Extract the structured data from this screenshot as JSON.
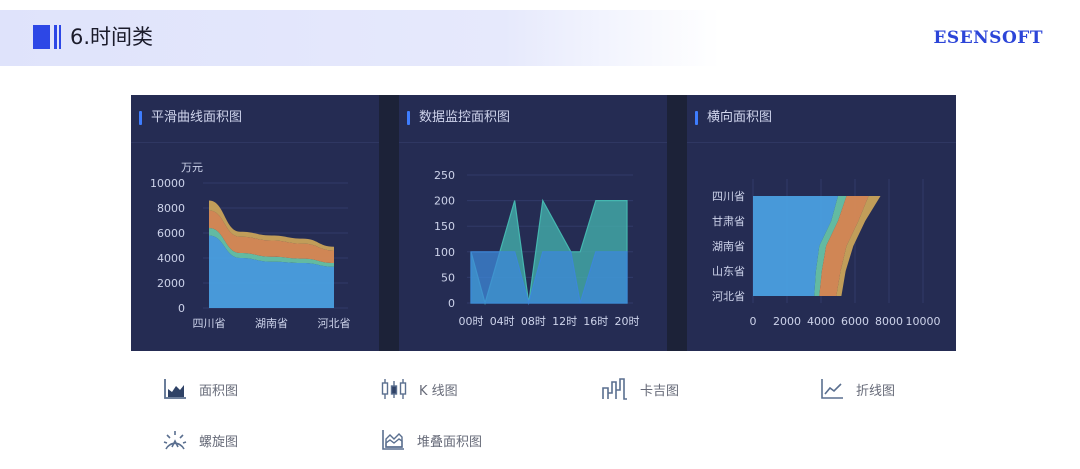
{
  "header": {
    "title": "6.时间类",
    "brand": "ESENSOFT",
    "accent_color": "#2d47e6"
  },
  "panels": [
    {
      "title": "平滑曲线面积图"
    },
    {
      "title": "数据监控面积图"
    },
    {
      "title": "横向面积图"
    }
  ],
  "chart_data": [
    {
      "type": "area",
      "title": "平滑曲线面积图",
      "ylabel": "万元",
      "categories": [
        "四川省",
        "",
        "湖南省",
        "",
        "河北省"
      ],
      "y_ticks": [
        "0",
        "2000",
        "4000",
        "6000",
        "8000",
        "10000"
      ],
      "ylim": [
        0,
        10000
      ],
      "stacked": true,
      "series": [
        {
          "values": [
            5800,
            4000,
            3700,
            3600,
            3300
          ],
          "color": "#4a9fe0"
        },
        {
          "values": [
            600,
            400,
            400,
            350,
            300
          ],
          "color": "#66c2a5"
        },
        {
          "values": [
            1400,
            1300,
            1300,
            1200,
            1000
          ],
          "color": "#d98b55"
        },
        {
          "values": [
            800,
            400,
            400,
            400,
            300
          ],
          "color": "#c9a35a"
        }
      ]
    },
    {
      "type": "area",
      "title": "数据监控面积图",
      "x": [
        "00时",
        "04时",
        "08时",
        "12时",
        "16时",
        "20时"
      ],
      "y_ticks": [
        "0",
        "50",
        "100",
        "150",
        "200",
        "250"
      ],
      "ylim": [
        0,
        250
      ],
      "series": [
        {
          "values": [
            100,
            0,
            200,
            0,
            200,
            100,
            100,
            200,
            200,
            200
          ],
          "color": "#45b7b0"
        },
        {
          "values": [
            100,
            100,
            100,
            0,
            100,
            100,
            0,
            100,
            100,
            100
          ],
          "color": "#3d88d8"
        }
      ]
    },
    {
      "type": "area",
      "title": "横向面积图",
      "orientation": "horizontal",
      "categories": [
        "河北省",
        "山东省",
        "湖南省",
        "甘肃省",
        "四川省"
      ],
      "x_ticks": [
        "0",
        "2000",
        "4000",
        "6000",
        "8000",
        "10000"
      ],
      "xlim": [
        0,
        10000
      ],
      "stacked": true,
      "series": [
        {
          "values": [
            3600,
            3700,
            3900,
            4600,
            5000
          ],
          "color": "#4a9fe0"
        },
        {
          "values": [
            300,
            350,
            400,
            400,
            500
          ],
          "color": "#66c2a5"
        },
        {
          "values": [
            1000,
            1100,
            1200,
            1200,
            1300
          ],
          "color": "#d98b55"
        },
        {
          "values": [
            300,
            300,
            400,
            400,
            700
          ],
          "color": "#c9a35a"
        }
      ]
    }
  ],
  "chart_types": [
    {
      "label": "面积图",
      "icon": "area-chart-icon"
    },
    {
      "label": "K 线图",
      "icon": "candlestick-icon"
    },
    {
      "label": "卡吉图",
      "icon": "kagi-chart-icon"
    },
    {
      "label": "折线图",
      "icon": "line-chart-icon"
    },
    {
      "label": "螺旋图",
      "icon": "spiral-chart-icon"
    },
    {
      "label": "堆叠面积图",
      "icon": "stacked-area-icon"
    }
  ]
}
